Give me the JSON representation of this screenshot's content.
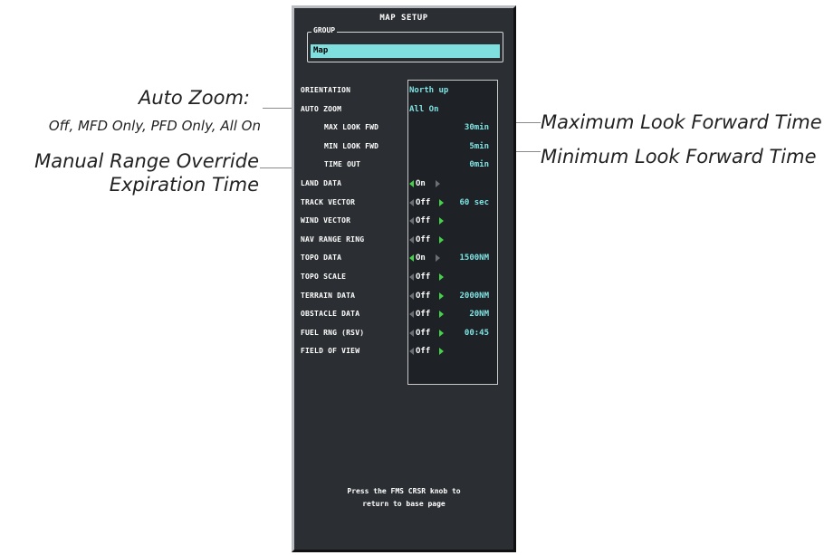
{
  "panel": {
    "title": "MAP SETUP",
    "group_label": "GROUP",
    "group_value": "Map",
    "footer_line1": "Press the FMS CRSR knob to",
    "footer_line2": "return to base page"
  },
  "rows": [
    {
      "label": "ORIENTATION",
      "value": "North up"
    },
    {
      "label": "AUTO ZOOM",
      "value": "All On"
    },
    {
      "label": "MAX LOOK FWD",
      "value": "30min"
    },
    {
      "label": "MIN LOOK FWD",
      "value": "5min"
    },
    {
      "label": "TIME OUT",
      "value": "0min"
    },
    {
      "label": "LAND DATA",
      "value": "On"
    },
    {
      "label": "TRACK VECTOR",
      "value": "Off",
      "extra": "60 sec"
    },
    {
      "label": "WIND VECTOR",
      "value": "Off"
    },
    {
      "label": "NAV RANGE RING",
      "value": "Off"
    },
    {
      "label": "TOPO DATA",
      "value": "On",
      "extra": "1500NM"
    },
    {
      "label": "TOPO SCALE",
      "value": "Off"
    },
    {
      "label": "TERRAIN DATA",
      "value": "Off",
      "extra": "2000NM"
    },
    {
      "label": "OBSTACLE DATA",
      "value": "Off",
      "extra": "20NM"
    },
    {
      "label": "FUEL RNG (RSV)",
      "value": "Off",
      "extra": "00:45"
    },
    {
      "label": "FIELD OF VIEW",
      "value": "Off"
    }
  ],
  "callouts": {
    "auto_zoom_title": "Auto Zoom:",
    "auto_zoom_options": "Off, MFD Only, PFD Only, All On",
    "manual_range_1": "Manual Range Override",
    "manual_range_2": "Expiration Time",
    "max_look": "Maximum Look Forward Time",
    "min_look": "Minimum Look Forward Time"
  },
  "colors": {
    "panel_bg": "#2b2f33",
    "value_cyan": "#7fe3e3",
    "group_field": "#7fdede",
    "arrow_active": "#44d24a"
  }
}
